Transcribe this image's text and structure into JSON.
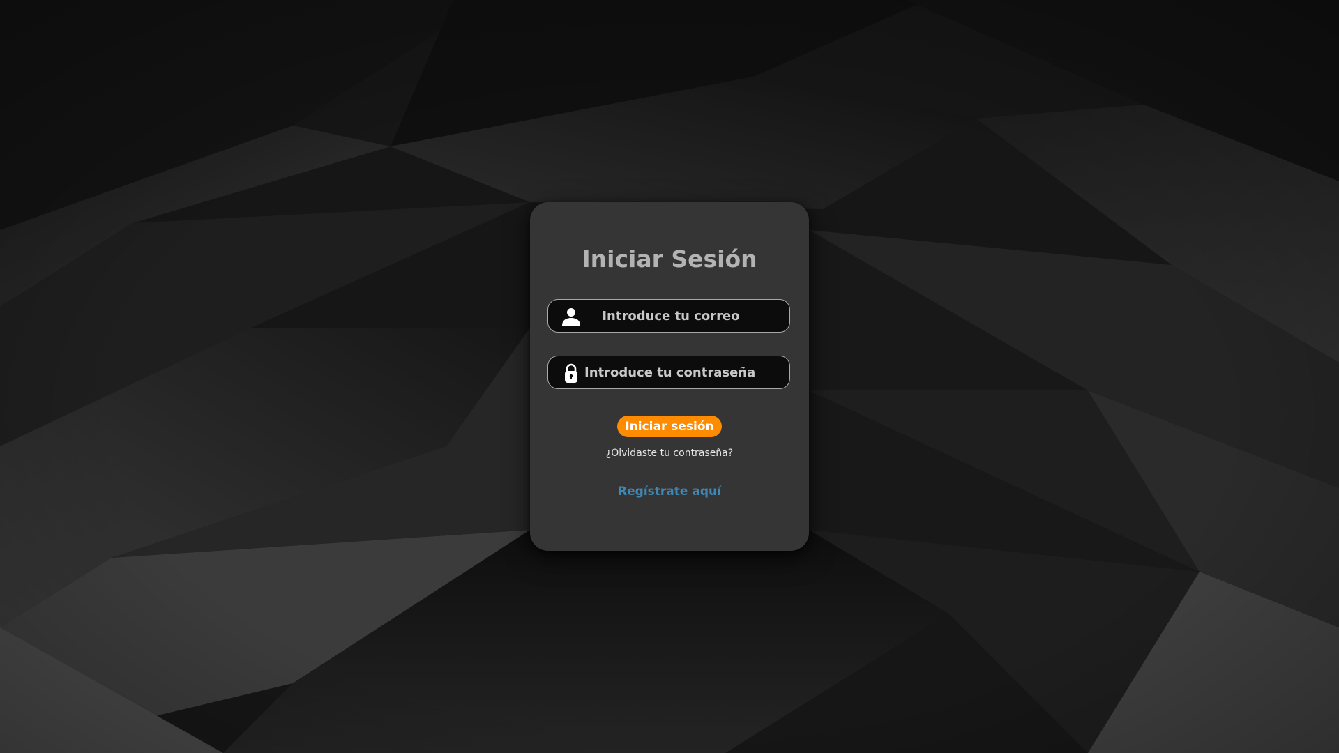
{
  "login": {
    "title": "Iniciar Sesión",
    "email_placeholder": "Introduce tu correo",
    "password_placeholder": "Introduce tu contraseña",
    "submit_label": "Iniciar sesión",
    "forgot_password_link": "¿Olvidaste tu contraseña?",
    "register_link": "Regístrate aquí"
  },
  "icons": {
    "email": "user-icon",
    "password": "lock-icon"
  },
  "colors": {
    "card_background": "#353535",
    "accent_button": "#ff8c00",
    "register_link": "#3f88b5",
    "input_background": "#0c0c0c",
    "title_text": "#b3b3b3"
  }
}
